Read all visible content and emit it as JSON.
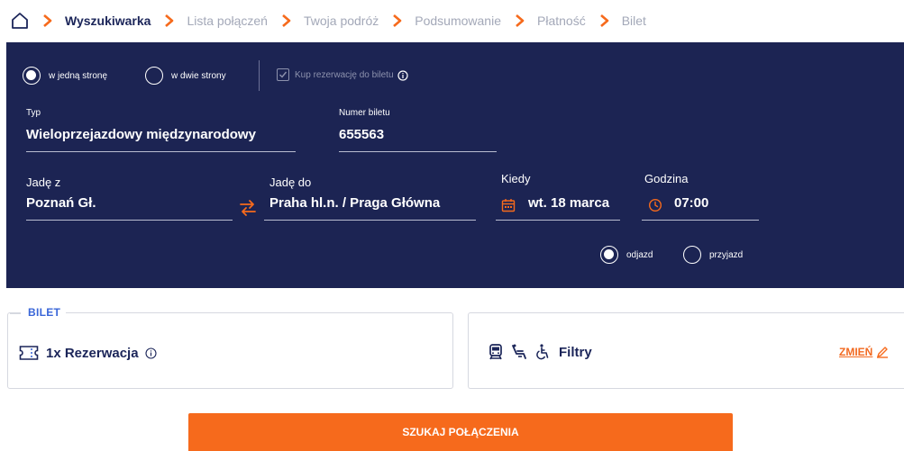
{
  "breadcrumb": {
    "items": [
      {
        "label": "Wyszukiwarka",
        "active": true
      },
      {
        "label": "Lista połączeń",
        "active": false
      },
      {
        "label": "Twoja podróż",
        "active": false
      },
      {
        "label": "Podsumowanie",
        "active": false
      },
      {
        "label": "Płatność",
        "active": false
      },
      {
        "label": "Bilet",
        "active": false
      }
    ]
  },
  "trip_type": {
    "one_way": "w jedną stronę",
    "round_trip": "w dwie strony",
    "selected": "one_way"
  },
  "reservation_checkbox": {
    "label": "Kup rezerwację do biletu",
    "checked": true
  },
  "ticket_type": {
    "label": "Typ",
    "value": "Wieloprzejazdowy międzynarodowy"
  },
  "ticket_number": {
    "label": "Numer biletu",
    "value": "655563"
  },
  "from": {
    "label": "Jadę z",
    "value": "Poznań Gł."
  },
  "to": {
    "label": "Jadę do",
    "value": "Praha hl.n. / Praga Główna"
  },
  "date": {
    "label": "Kiedy",
    "value": "wt. 18 marca"
  },
  "time": {
    "label": "Godzina",
    "value": "07:00"
  },
  "time_mode": {
    "departure": "odjazd",
    "arrival": "przyjazd",
    "selected": "departure"
  },
  "ticket_box": {
    "legend": "BILET",
    "summary": "1x Rezerwacja"
  },
  "filters_box": {
    "label": "Filtry",
    "change_label": "ZMIEŃ"
  },
  "search_button": {
    "label": "SZUKAJ POŁĄCZENIA"
  },
  "colors": {
    "panel": "#1c2453",
    "accent": "#f66a1c",
    "link_blue": "#3a66d8",
    "text_dark": "#1b2559"
  }
}
